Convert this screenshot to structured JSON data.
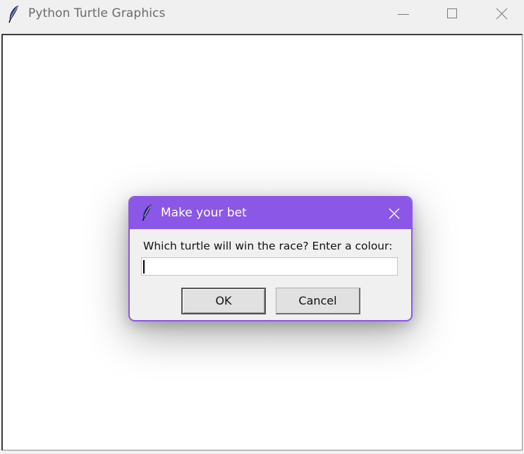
{
  "window": {
    "title": "Python Turtle Graphics",
    "app_icon": "feather-icon",
    "controls": [
      "minimize-icon",
      "maximize-icon",
      "close-icon"
    ]
  },
  "dialog": {
    "title": "Make your bet",
    "icon": "feather-icon",
    "accent_color": "#8b57e6",
    "prompt": "Which turtle will win the race? Enter a colour:",
    "input_value": "",
    "ok_label": "OK",
    "cancel_label": "Cancel"
  }
}
